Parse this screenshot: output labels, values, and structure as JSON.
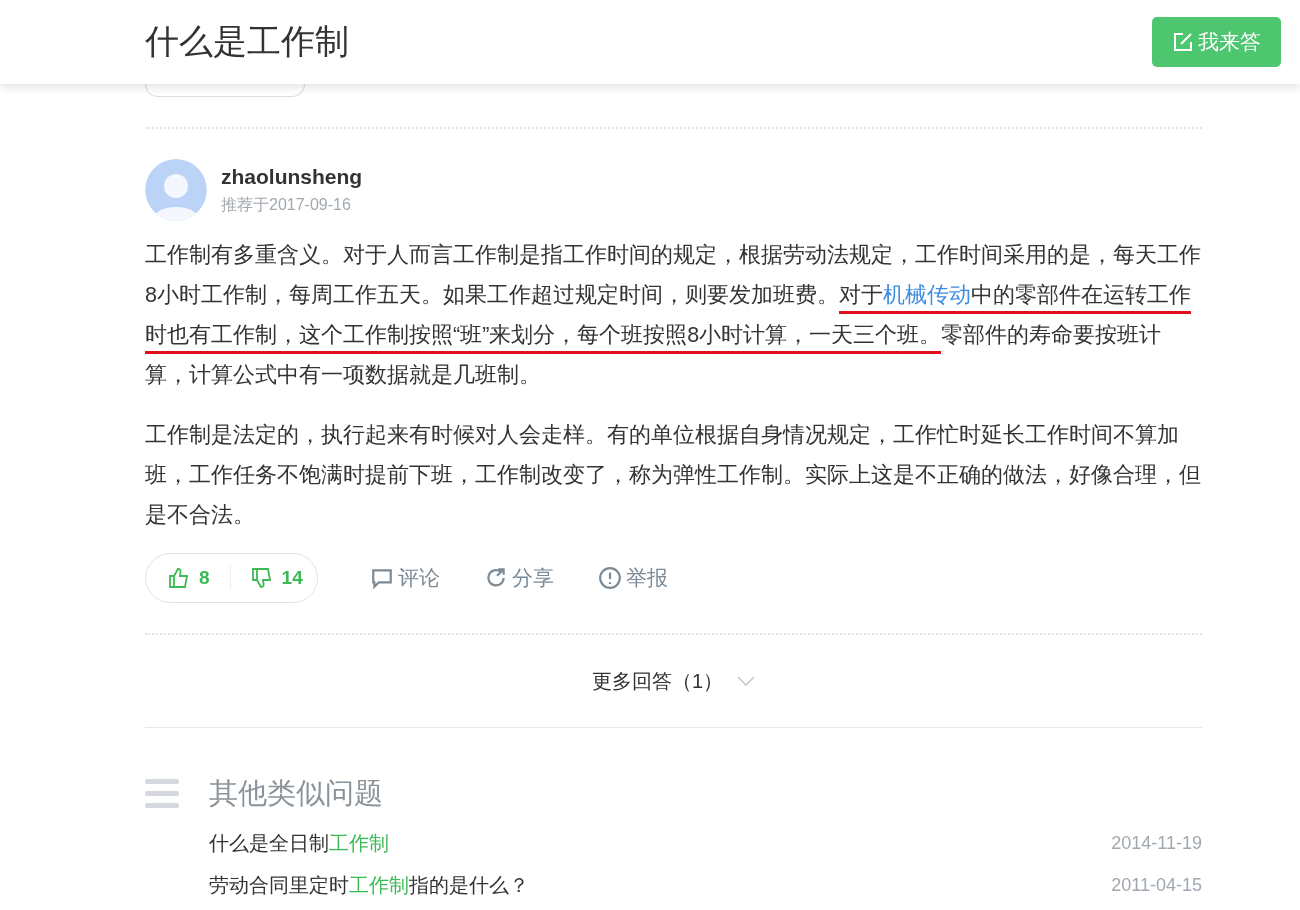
{
  "header": {
    "title": "什么是工作制",
    "answer_button": "我来答"
  },
  "answer": {
    "author": "zhaolunsheng",
    "date": "推荐于2017-09-16",
    "paragraphs": [
      [
        {
          "text": "工作制有多重含义。对于人而言工作制是指工作时间的规定，根据劳动法规定，工作时间采用的是，每天工作8小时工作制，每周工作五天。如果工作超过规定时间，则要发加班费。",
          "kind": "plain",
          "underlined": false
        },
        {
          "text": "对于",
          "kind": "plain",
          "underlined": true
        },
        {
          "text": "机械传动",
          "kind": "link",
          "underlined": true
        },
        {
          "text": "中的零部件在运转工作时也有工作制，这个工作制按照“班”来划分，每个班按照8小时计算，一天三个班。",
          "kind": "plain",
          "underlined": true
        },
        {
          "text": "零部件的寿命要按班计算，计算公式中有一项数据就是几班制。",
          "kind": "plain",
          "underlined": false
        }
      ],
      [
        {
          "text": "工作制是法定的，执行起来有时候对人会走样。有的单位根据自身情况规定，工作忙时延长工作时间不算加班，工作任务不饱满时提前下班，工作制改变了，称为弹性工作制。实际上这是不正确的做法，好像合理，但是不合法。",
          "kind": "plain",
          "underlined": false
        }
      ]
    ],
    "likes": "8",
    "dislikes": "14",
    "actions": [
      {
        "label": "评论",
        "kind": "comment"
      },
      {
        "label": "分享",
        "kind": "share"
      },
      {
        "label": "举报",
        "kind": "report"
      }
    ]
  },
  "more_answers": "更多回答（1）",
  "similar": {
    "title": "其他类似问题",
    "items": [
      {
        "parts": [
          {
            "text": "什么是全日制",
            "highlight": false
          },
          {
            "text": "工作制",
            "highlight": true
          }
        ],
        "date": "2014-11-19"
      },
      {
        "parts": [
          {
            "text": "劳动合同里定时",
            "highlight": false
          },
          {
            "text": "工作制",
            "highlight": true
          },
          {
            "text": "指的是什么？",
            "highlight": false
          }
        ],
        "date": "2011-04-15"
      }
    ]
  }
}
